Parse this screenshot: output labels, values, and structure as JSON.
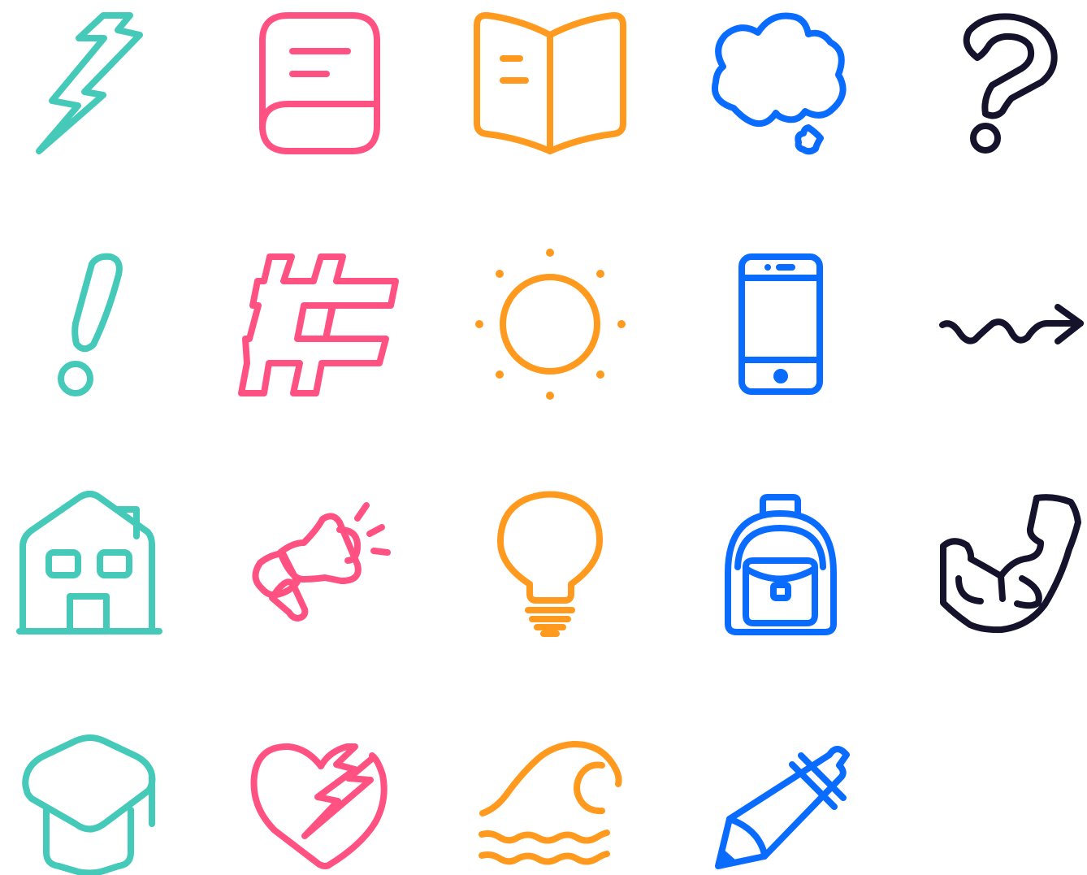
{
  "palette": {
    "teal": "#45c9b8",
    "pink": "#ff5283",
    "orange": "#ff9a1f",
    "blue": "#0a6cff",
    "navy": "#14132b"
  },
  "icons": [
    {
      "name": "lightning-bolt-icon",
      "color": "teal"
    },
    {
      "name": "book-icon",
      "color": "pink"
    },
    {
      "name": "open-book-icon",
      "color": "orange"
    },
    {
      "name": "thought-bubble-icon",
      "color": "blue"
    },
    {
      "name": "question-mark-icon",
      "color": "navy"
    },
    {
      "name": "exclamation-mark-icon",
      "color": "teal"
    },
    {
      "name": "hashtag-icon",
      "color": "pink"
    },
    {
      "name": "sun-icon",
      "color": "orange"
    },
    {
      "name": "smartphone-icon",
      "color": "blue"
    },
    {
      "name": "squiggle-arrow-icon",
      "color": "navy"
    },
    {
      "name": "house-icon",
      "color": "teal"
    },
    {
      "name": "megaphone-icon",
      "color": "pink"
    },
    {
      "name": "light-bulb-icon",
      "color": "orange"
    },
    {
      "name": "backpack-icon",
      "color": "blue"
    },
    {
      "name": "flexed-bicep-icon",
      "color": "navy"
    },
    {
      "name": "graduation-cap-icon",
      "color": "teal"
    },
    {
      "name": "broken-heart-icon",
      "color": "pink"
    },
    {
      "name": "ocean-wave-icon",
      "color": "orange"
    },
    {
      "name": "pencil-icon",
      "color": "blue"
    }
  ]
}
